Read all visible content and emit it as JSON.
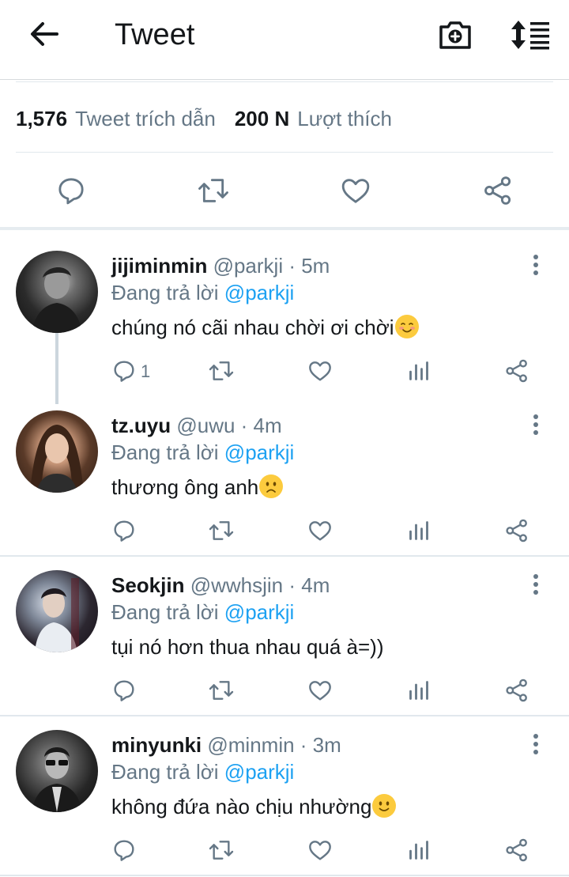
{
  "header": {
    "title": "Tweet",
    "icons": [
      "back-arrow-icon",
      "camera-plus-icon",
      "sort-icon"
    ]
  },
  "stats": {
    "quotes_count": "1,576",
    "quotes_label": "Tweet trích dẫn",
    "likes_count": "200 N",
    "likes_label": "Lượt thích"
  },
  "main_actions": [
    "reply-icon",
    "retweet-icon",
    "like-icon",
    "share-icon"
  ],
  "colors": {
    "link": "#1da1f2",
    "muted": "#657786",
    "text": "#14171a",
    "divider": "#e1e8ed"
  },
  "replies": [
    {
      "name": "jijiminmin",
      "handle": "@parkji",
      "time": "· 5m",
      "replying_prefix": "Đang trả lời",
      "replying_to": "@parkji",
      "text": "chúng nó cãi nhau chời ơi chời",
      "emoji": "smiling-blush",
      "reply_count": "1"
    },
    {
      "name": "tz.uyu",
      "handle": "@uwu",
      "time": "· 4m",
      "replying_prefix": "Đang trả lời",
      "replying_to": "@parkji",
      "text": "thương ông anh",
      "emoji": "frowning",
      "reply_count": ""
    },
    {
      "name": "Seokjin",
      "handle": "@wwhsjin",
      "time": "· 4m",
      "replying_prefix": "Đang trả lời",
      "replying_to": "@parkji",
      "text": "tụi nó hơn thua nhau quá à=))",
      "emoji": "",
      "reply_count": ""
    },
    {
      "name": "minyunki",
      "handle": "@minmin",
      "time": "· 3m",
      "replying_prefix": "Đang trả lời",
      "replying_to": "@parkji",
      "text": "không đứa nào chịu nhường",
      "emoji": "slight-smile",
      "reply_count": ""
    }
  ]
}
